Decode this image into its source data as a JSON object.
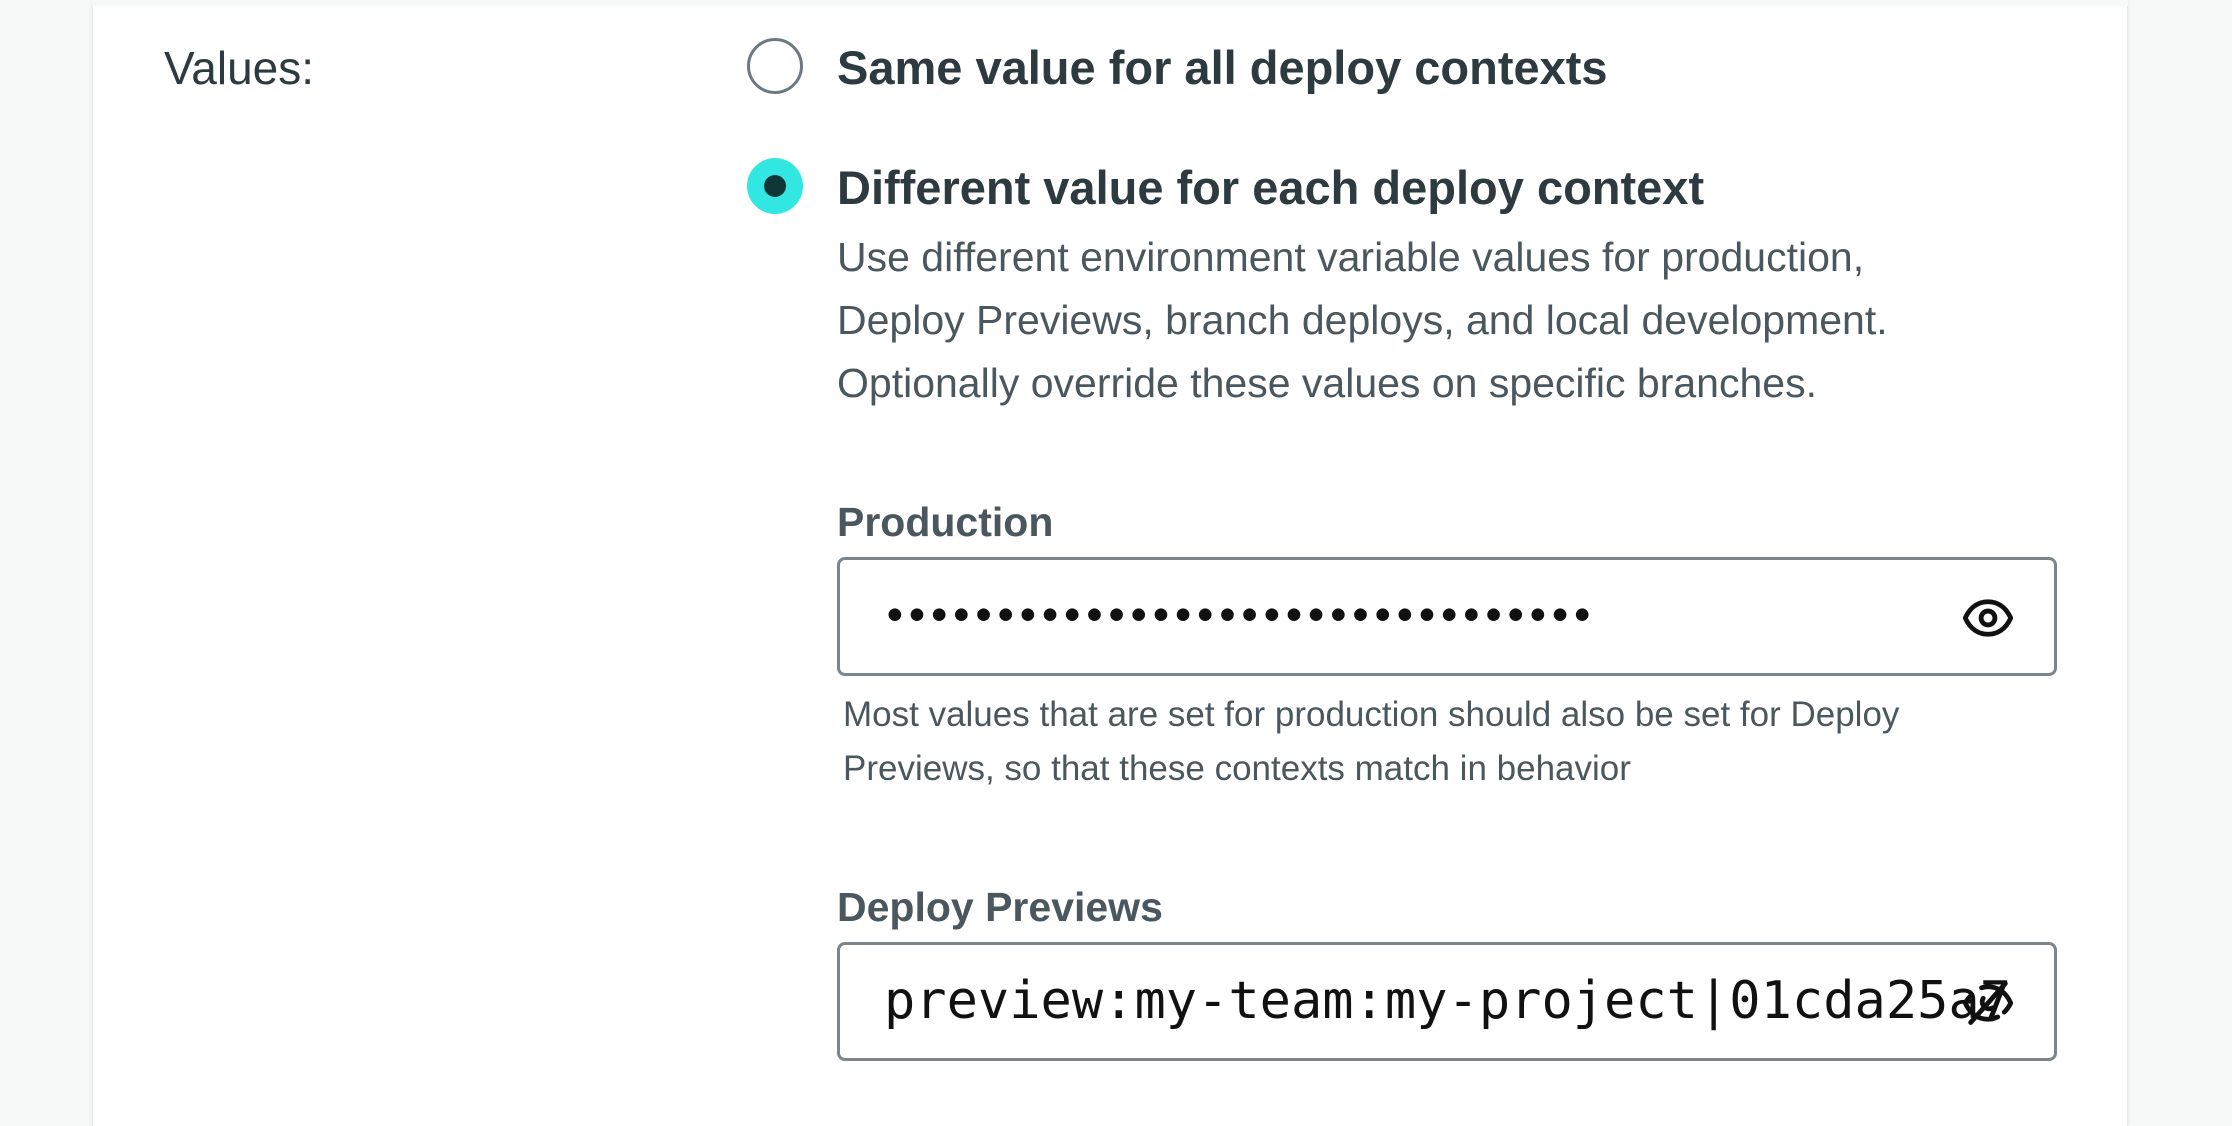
{
  "values_label": "Values:",
  "options": [
    {
      "title": "Same value for all deploy contexts",
      "selected": false
    },
    {
      "title": "Different value for each deploy context",
      "selected": true,
      "description_lines": [
        "Use different environment variable values for production,",
        "Deploy Previews, branch deploys, and local development.",
        "Optionally override these values on specific branches."
      ]
    }
  ],
  "fields": {
    "production": {
      "label": "Production",
      "value": "••••••••••••••••••••••••••••••••",
      "visibility_icon": "eye-icon",
      "help_lines": [
        "Most values that are set for production should also be set for Deploy",
        "Previews, so that these contexts match in behavior"
      ]
    },
    "deploy_previews": {
      "label": "Deploy Previews",
      "value": "preview:my-team:my-project|01cda25a7",
      "visibility_icon": "eye-off-icon"
    }
  },
  "colors": {
    "accent": "#32e6e2",
    "accent_dot": "#0f3536",
    "text_primary": "#2d3b41",
    "text_secondary": "#4a575e",
    "input_border": "#7a868c"
  }
}
